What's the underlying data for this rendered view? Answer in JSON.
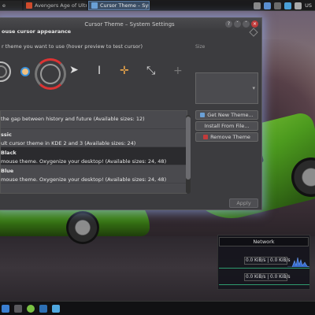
{
  "colors": {
    "accent": "#5a7da3",
    "window_bg": "#3c3c3f",
    "selected_row": "#2b2b2e",
    "close_button": "#bf3b3b",
    "graph": "#2e9b6e"
  },
  "top_panel": {
    "tasks": [
      {
        "label": "e",
        "active": false,
        "icon": "app-icon"
      },
      {
        "label": "Avengers Age of Ultron",
        "active": false,
        "icon": "browser-icon"
      },
      {
        "label": "Cursor Theme – Syst",
        "active": true,
        "icon": "settings-icon"
      }
    ],
    "tray_text": "US"
  },
  "window": {
    "title": "Cursor Theme – System Settings",
    "buttons": {
      "help": "?",
      "minimize": "ˇ",
      "maximize": "ˆ",
      "close": "×"
    },
    "section_title": "ouse cursor appearance",
    "hint": "r theme you want to use (hover preview to test cursor)",
    "size_label": "Size",
    "themes": [
      {
        "name": "",
        "description": "the gap between history and future (Available sizes: 12)",
        "selected": false
      },
      {
        "name": "ssic",
        "description": "ult cursor theme in KDE 2 and 3 (Available sizes: 24)",
        "selected": false
      },
      {
        "name": "Black",
        "description": "mouse theme. Oxygenize your desktop! (Available sizes: 24, 48)",
        "selected": true
      },
      {
        "name": "Blue",
        "description": "mouse theme. Oxygenize your desktop! (Available sizes: 24, 48)",
        "selected": false
      }
    ],
    "buttons_side": {
      "get_new": "Get New Theme...",
      "install": "Install From File...",
      "remove": "Remove Theme"
    },
    "apply": "Apply"
  },
  "network": {
    "title": "Network",
    "rows": [
      "0.0 KiB/s | 0.0 KiB/s",
      "0.0 KiB/s | 0.0 KiB/s"
    ]
  }
}
